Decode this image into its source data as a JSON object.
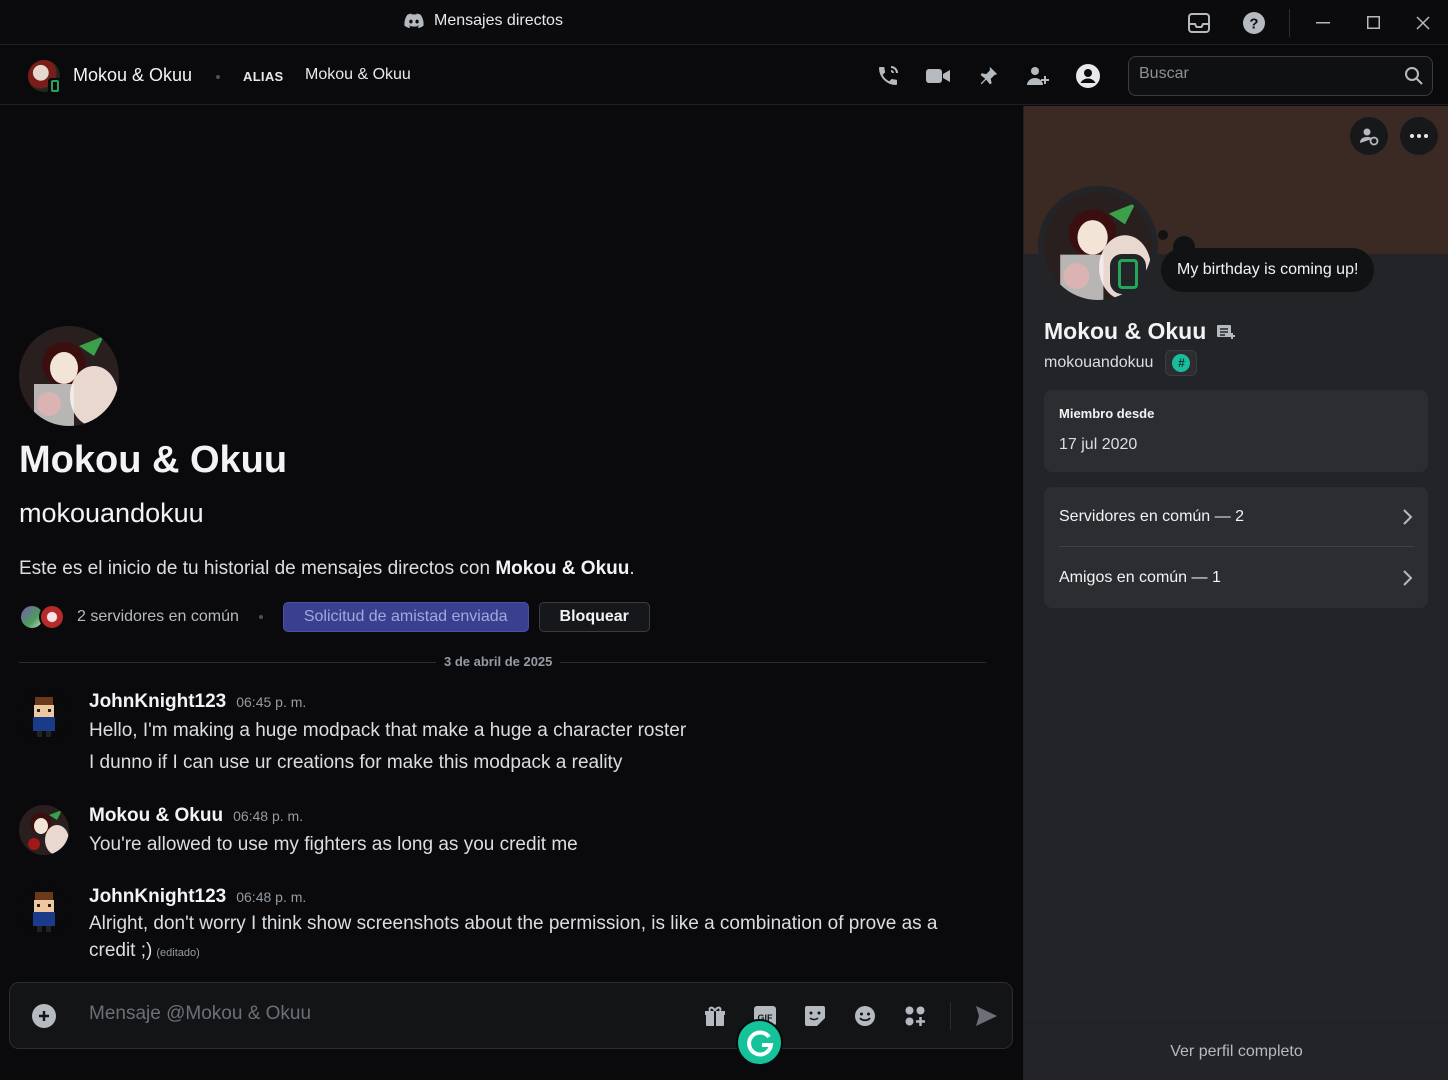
{
  "window": {
    "title": "Mensajes directos"
  },
  "header": {
    "name": "Mokou & Okuu",
    "alias_label": "ALIAS",
    "alias_value": "Mokou & Okuu",
    "search_placeholder": "Buscar",
    "icons": [
      "voice-call-icon",
      "video-call-icon",
      "pin-icon",
      "add-friends-icon",
      "user-profile-icon"
    ]
  },
  "welcome": {
    "display_name": "Mokou & Okuu",
    "username": "mokouandokuu",
    "intro_prefix": "Este es el inicio de tu historial de mensajes directos con ",
    "intro_name": "Mokou & Okuu",
    "intro_suffix": ".",
    "mutual_servers": "2 servidores en común",
    "friend_request_label": "Solicitud de amistad enviada",
    "block_label": "Bloquear"
  },
  "date_divider": "3 de abril de 2025",
  "messages": [
    {
      "author": "JohnKnight123",
      "time": "06:45 p. m.",
      "lines": [
        "Hello, I'm making a huge modpack that make a huge a character roster",
        "I dunno if I can use ur creations for make this modpack a reality"
      ]
    },
    {
      "author": "Mokou & Okuu",
      "time": "06:48 p. m.",
      "lines": [
        "You're allowed to use my fighters as long as you credit me"
      ]
    },
    {
      "author": "JohnKnight123",
      "time": "06:48 p. m.",
      "lines": [
        "Alright, don't worry I think show screenshots about the permission, is like a combination of prove as a",
        "credit ;)"
      ],
      "edited": "(editado)"
    }
  ],
  "composer": {
    "placeholder": "Mensaje @Mokou & Okuu",
    "icons": [
      "gift-icon",
      "gif-icon",
      "sticker-icon",
      "emoji-icon",
      "apps-icon",
      "send-icon"
    ]
  },
  "profile": {
    "display_name": "Mokou & Okuu",
    "username": "mokouandokuu",
    "custom_status": "My birthday is coming up!",
    "member_since_label": "Miembro desde",
    "member_since_value": "17 jul 2020",
    "mutual_servers": "Servidores en común — 2",
    "mutual_friends": "Amigos en común — 1",
    "view_full_profile": "Ver perfil completo",
    "badge_glyph": "#"
  },
  "colors": {
    "accent_friend_button": "#3b3f8f",
    "online_green": "#23a55a",
    "banner": "#3a2a23",
    "grammarly": "#15c39a"
  }
}
